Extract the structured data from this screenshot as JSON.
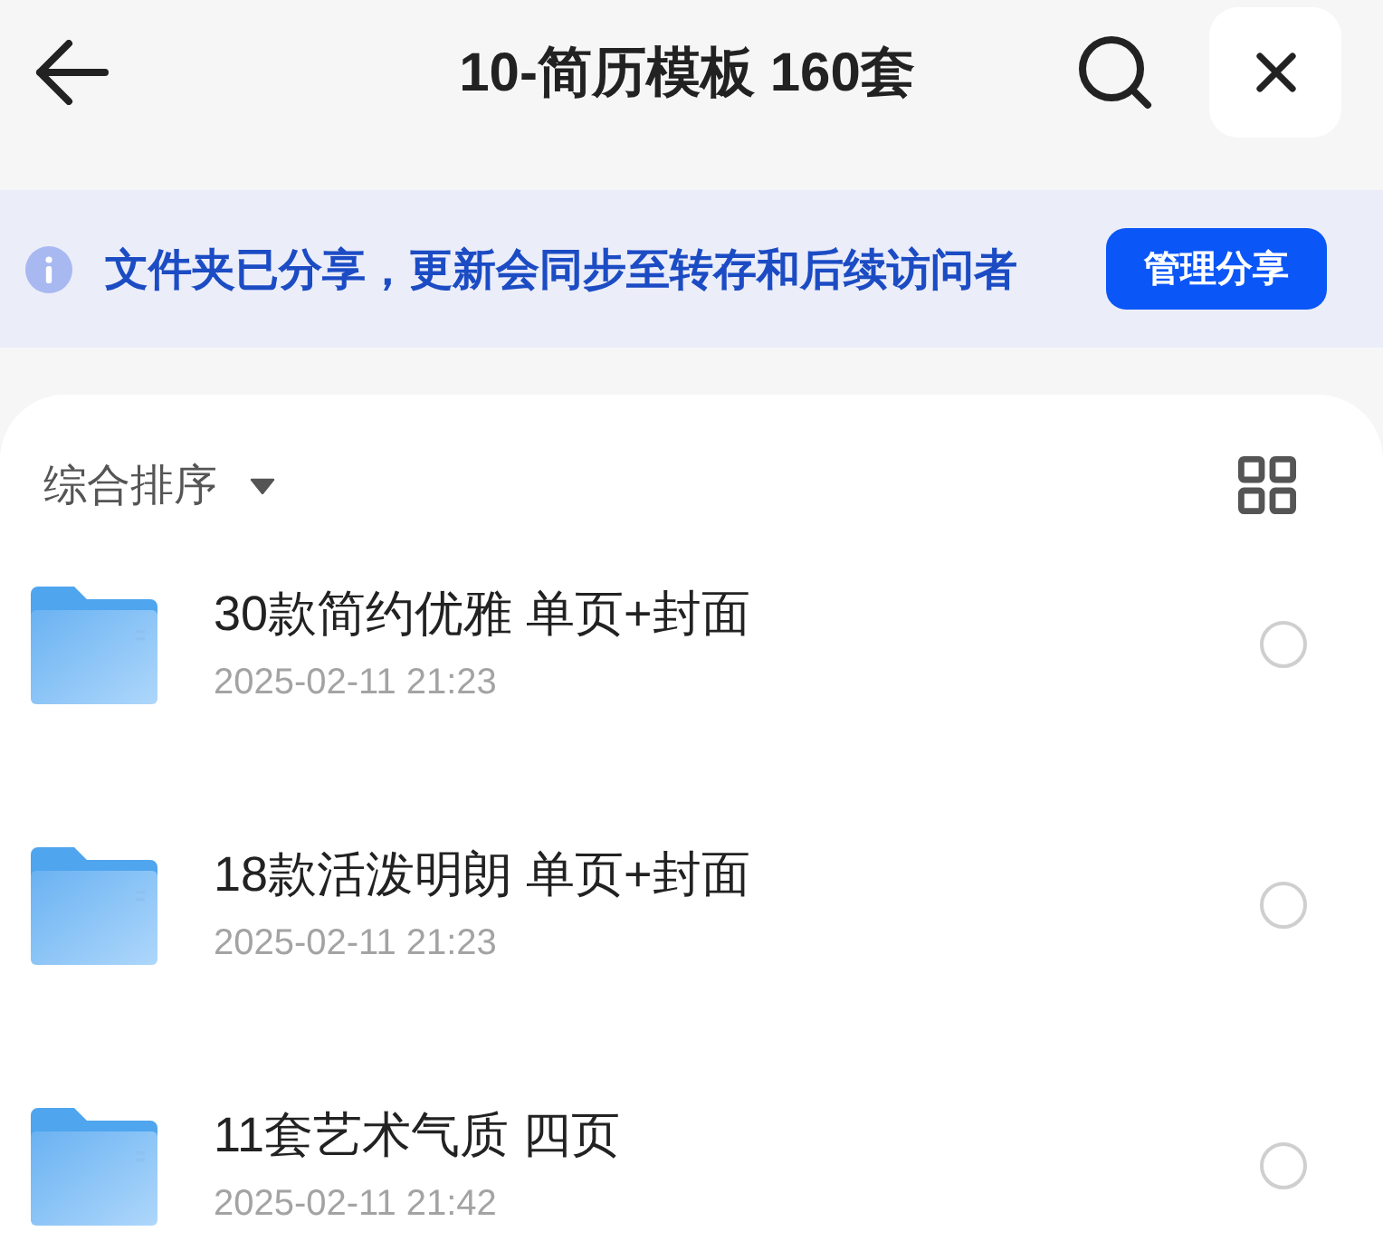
{
  "header": {
    "title": "10-简历模板 160套"
  },
  "banner": {
    "message": "文件夹已分享，更新会同步至转存和后续访问者",
    "button": "管理分享"
  },
  "sort": {
    "label": "综合排序"
  },
  "files": [
    {
      "name": "30款简约优雅 单页+封面",
      "date": "2025-02-11 21:23",
      "selected": false
    },
    {
      "name": "18款活泼明朗 单页+封面",
      "date": "2025-02-11 21:23",
      "selected": false
    },
    {
      "name": "11套艺术气质 四页",
      "date": "2025-02-11 21:42",
      "selected": false
    }
  ]
}
